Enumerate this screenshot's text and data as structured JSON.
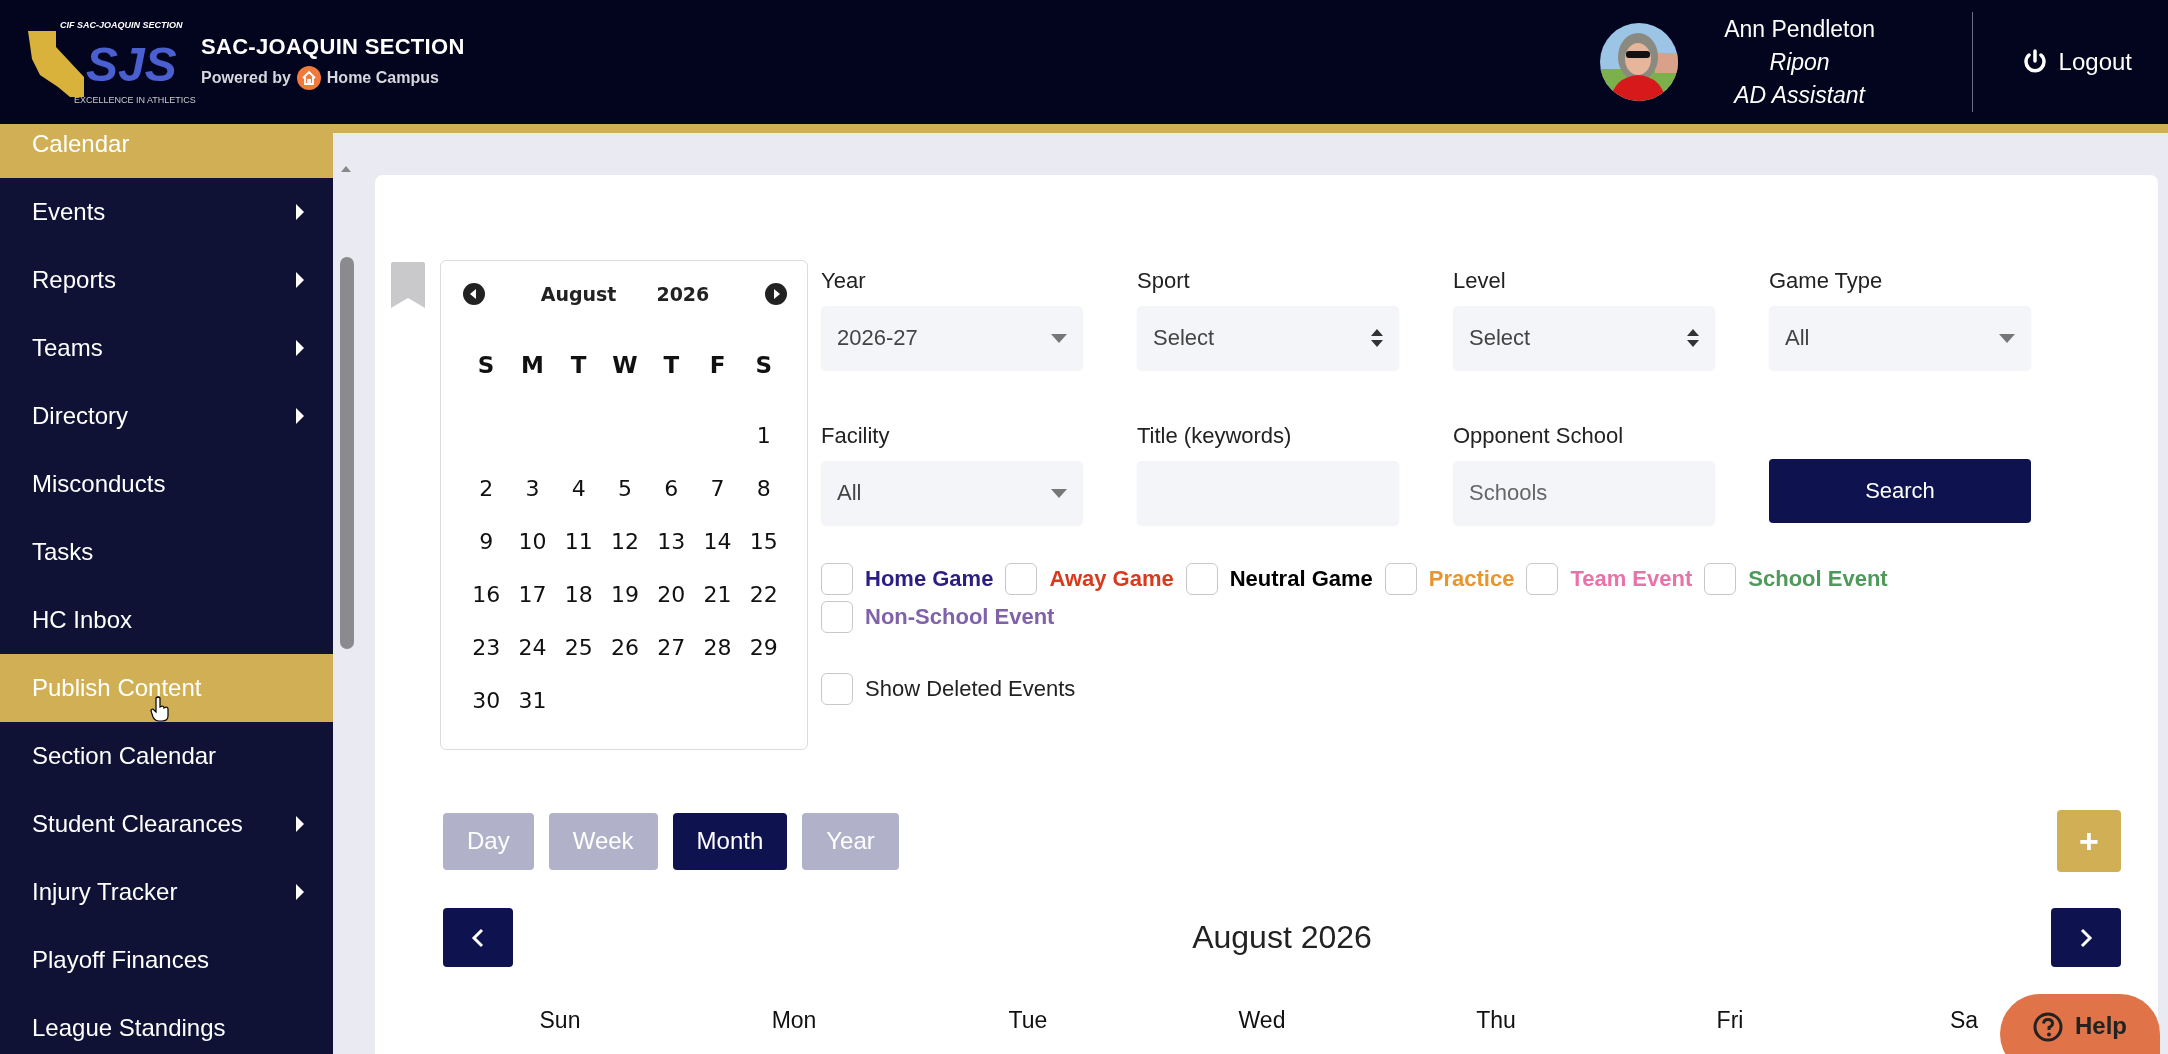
{
  "header": {
    "logo": {
      "top_text": "CIF SAC-JOAQUIN SECTION",
      "main_text": "SJS",
      "bottom_text": "EXCELLENCE IN ATHLETICS"
    },
    "title": "SAC-JOAQUIN SECTION",
    "powered_by": "Powered by",
    "brand": "Home Campus",
    "user": {
      "name": "Ann Pendleton",
      "school": "Ripon",
      "role": "AD Assistant"
    },
    "logout": "Logout"
  },
  "sidebar": {
    "items": [
      {
        "label": "Calendar",
        "selected": true,
        "has_submenu": false,
        "hovered": false
      },
      {
        "label": "Events",
        "selected": false,
        "has_submenu": true,
        "hovered": false
      },
      {
        "label": "Reports",
        "selected": false,
        "has_submenu": true,
        "hovered": false
      },
      {
        "label": "Teams",
        "selected": false,
        "has_submenu": true,
        "hovered": false
      },
      {
        "label": "Directory",
        "selected": false,
        "has_submenu": true,
        "hovered": false
      },
      {
        "label": "Misconducts",
        "selected": false,
        "has_submenu": false,
        "hovered": false
      },
      {
        "label": "Tasks",
        "selected": false,
        "has_submenu": false,
        "hovered": false
      },
      {
        "label": "HC Inbox",
        "selected": false,
        "has_submenu": false,
        "hovered": false
      },
      {
        "label": "Publish Content",
        "selected": true,
        "has_submenu": false,
        "hovered": true
      },
      {
        "label": "Section Calendar",
        "selected": false,
        "has_submenu": false,
        "hovered": false
      },
      {
        "label": "Student Clearances",
        "selected": false,
        "has_submenu": true,
        "hovered": false
      },
      {
        "label": "Injury Tracker",
        "selected": false,
        "has_submenu": true,
        "hovered": false
      },
      {
        "label": "Playoff Finances",
        "selected": false,
        "has_submenu": false,
        "hovered": false
      },
      {
        "label": "League Standings",
        "selected": false,
        "has_submenu": false,
        "hovered": false
      }
    ]
  },
  "mini_calendar": {
    "month": "August",
    "year": "2026",
    "weekdays": [
      "S",
      "M",
      "T",
      "W",
      "T",
      "F",
      "S"
    ],
    "weeks": [
      [
        "1"
      ],
      [
        "2",
        "3",
        "4",
        "5",
        "6",
        "7",
        "8"
      ],
      [
        "9",
        "10",
        "11",
        "12",
        "13",
        "14",
        "15"
      ],
      [
        "16",
        "17",
        "18",
        "19",
        "20",
        "21",
        "22"
      ],
      [
        "23",
        "24",
        "25",
        "26",
        "27",
        "28",
        "29"
      ],
      [
        "30",
        "31"
      ]
    ]
  },
  "filters": [
    {
      "label": "Year",
      "kind": "dropdown",
      "value": "2026-27"
    },
    {
      "label": "Sport",
      "kind": "select",
      "value": "Select"
    },
    {
      "label": "Level",
      "kind": "select",
      "value": "Select"
    },
    {
      "label": "Game Type",
      "kind": "dropdown",
      "value": "All"
    },
    {
      "label": "Facility",
      "kind": "dropdown",
      "value": "All"
    },
    {
      "label": "Title (keywords)",
      "kind": "text"
    },
    {
      "label": "Opponent School",
      "kind": "text",
      "placeholder": "Schools"
    }
  ],
  "search_button": "Search",
  "event_types": [
    {
      "label": "Home Game",
      "checked": false,
      "color": "#2b1e83"
    },
    {
      "label": "Away Game",
      "checked": false,
      "color": "#d9391c"
    },
    {
      "label": "Neutral Game",
      "checked": false,
      "color": "#000000"
    },
    {
      "label": "Practice",
      "checked": false,
      "color": "#e8952c"
    },
    {
      "label": "Team Event",
      "checked": false,
      "color": "#e872a9"
    },
    {
      "label": "School Event",
      "checked": false,
      "color": "#4e9a5a"
    },
    {
      "label": "Non-School Event",
      "checked": false,
      "color": "#7f62a8"
    }
  ],
  "show_deleted": {
    "label": "Show Deleted Events",
    "checked": false
  },
  "views": [
    {
      "label": "Day",
      "selected": false
    },
    {
      "label": "Week",
      "selected": false
    },
    {
      "label": "Month",
      "selected": true
    },
    {
      "label": "Year",
      "selected": false
    }
  ],
  "add_button": "+",
  "calendar": {
    "title": "August 2026",
    "weekdays": [
      "Sun",
      "Mon",
      "Tue",
      "Wed",
      "Thu",
      "Fri",
      "Sa"
    ]
  },
  "help_button": "Help"
}
